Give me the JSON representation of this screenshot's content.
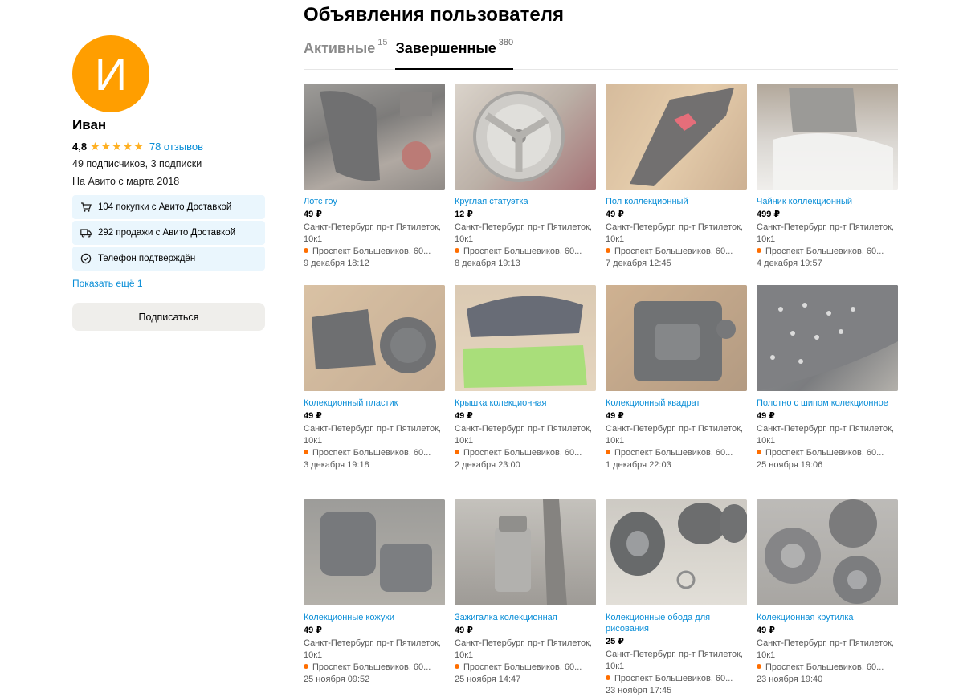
{
  "page_title": "Объявления пользователя",
  "tabs": [
    {
      "label": "Активные",
      "count": "15",
      "active": false
    },
    {
      "label": "Завершенные",
      "count": "380",
      "active": true
    }
  ],
  "profile": {
    "avatar_letter": "И",
    "name": "Иван",
    "rating": "4,8",
    "stars": "★★★★★",
    "reviews": "78 отзывов",
    "subscriptions": "49 подписчиков, 3 подписки",
    "since": "На Авито с марта 2018",
    "badges": [
      {
        "icon": "cart-icon",
        "text": "104 покупки с Авито Доставкой"
      },
      {
        "icon": "truck-icon",
        "text": "292 продажи с Авито Доставкой"
      },
      {
        "icon": "check-circle-icon",
        "text": "Телефон подтверждён"
      }
    ],
    "show_more": "Показать ещё 1",
    "subscribe": "Подписаться"
  },
  "listings": [
    {
      "title": "Лотс гоу",
      "price": "49 ₽",
      "address": "Санкт-Петербург, пр-т Пятилеток, 10к1",
      "metro": "Проспект Большевиков, 60...",
      "date": "9 декабря 18:12"
    },
    {
      "title": "Круглая статуэтка",
      "price": "12 ₽",
      "address": "Санкт-Петербург, пр-т Пятилеток, 10к1",
      "metro": "Проспект Большевиков, 60...",
      "date": "8 декабря 19:13"
    },
    {
      "title": "Пол коллекционный",
      "price": "49 ₽",
      "address": "Санкт-Петербург, пр-т Пятилеток, 10к1",
      "metro": "Проспект Большевиков, 60...",
      "date": "7 декабря 12:45"
    },
    {
      "title": "Чайник коллекционный",
      "price": "499 ₽",
      "address": "Санкт-Петербург, пр-т Пятилеток, 10к1",
      "metro": "Проспект Большевиков, 60...",
      "date": "4 декабря 19:57"
    },
    {
      "title": "Колекционный пластик",
      "price": "49 ₽",
      "address": "Санкт-Петербург, пр-т Пятилеток, 10к1",
      "metro": "Проспект Большевиков, 60...",
      "date": "3 декабря 19:18"
    },
    {
      "title": "Крышка колекционная",
      "price": "49 ₽",
      "address": "Санкт-Петербург, пр-т Пятилеток, 10к1",
      "metro": "Проспект Большевиков, 60...",
      "date": "2 декабря 23:00"
    },
    {
      "title": "Колекционный квадрат",
      "price": "49 ₽",
      "address": "Санкт-Петербург, пр-т Пятилеток, 10к1",
      "metro": "Проспект Большевиков, 60...",
      "date": "1 декабря 22:03"
    },
    {
      "title": "Полотно с шипом колекционное",
      "price": "49 ₽",
      "address": "Санкт-Петербург, пр-т Пятилеток, 10к1",
      "metro": "Проспект Большевиков, 60...",
      "date": "25 ноября 19:06"
    },
    {
      "title": "Колекционные кожухи",
      "price": "49 ₽",
      "address": "Санкт-Петербург, пр-т Пятилеток, 10к1",
      "metro": "Проспект Большевиков, 60...",
      "date": "25 ноября 09:52"
    },
    {
      "title": "Зажигалка колекционная",
      "price": "49 ₽",
      "address": "Санкт-Петербург, пр-т Пятилеток, 10к1",
      "metro": "Проспект Большевиков, 60...",
      "date": "25 ноября 14:47"
    },
    {
      "title": "Колекционные обода для рисования",
      "price": "25 ₽",
      "address": "Санкт-Петербург, пр-т Пятилеток, 10к1",
      "metro": "Проспект Большевиков, 60...",
      "date": "23 ноября 17:45"
    },
    {
      "title": "Колекционная крутилка",
      "price": "49 ₽",
      "address": "Санкт-Петербург, пр-т Пятилеток, 10к1",
      "metro": "Проспект Большевиков, 60...",
      "date": "23 ноября 19:40"
    }
  ]
}
